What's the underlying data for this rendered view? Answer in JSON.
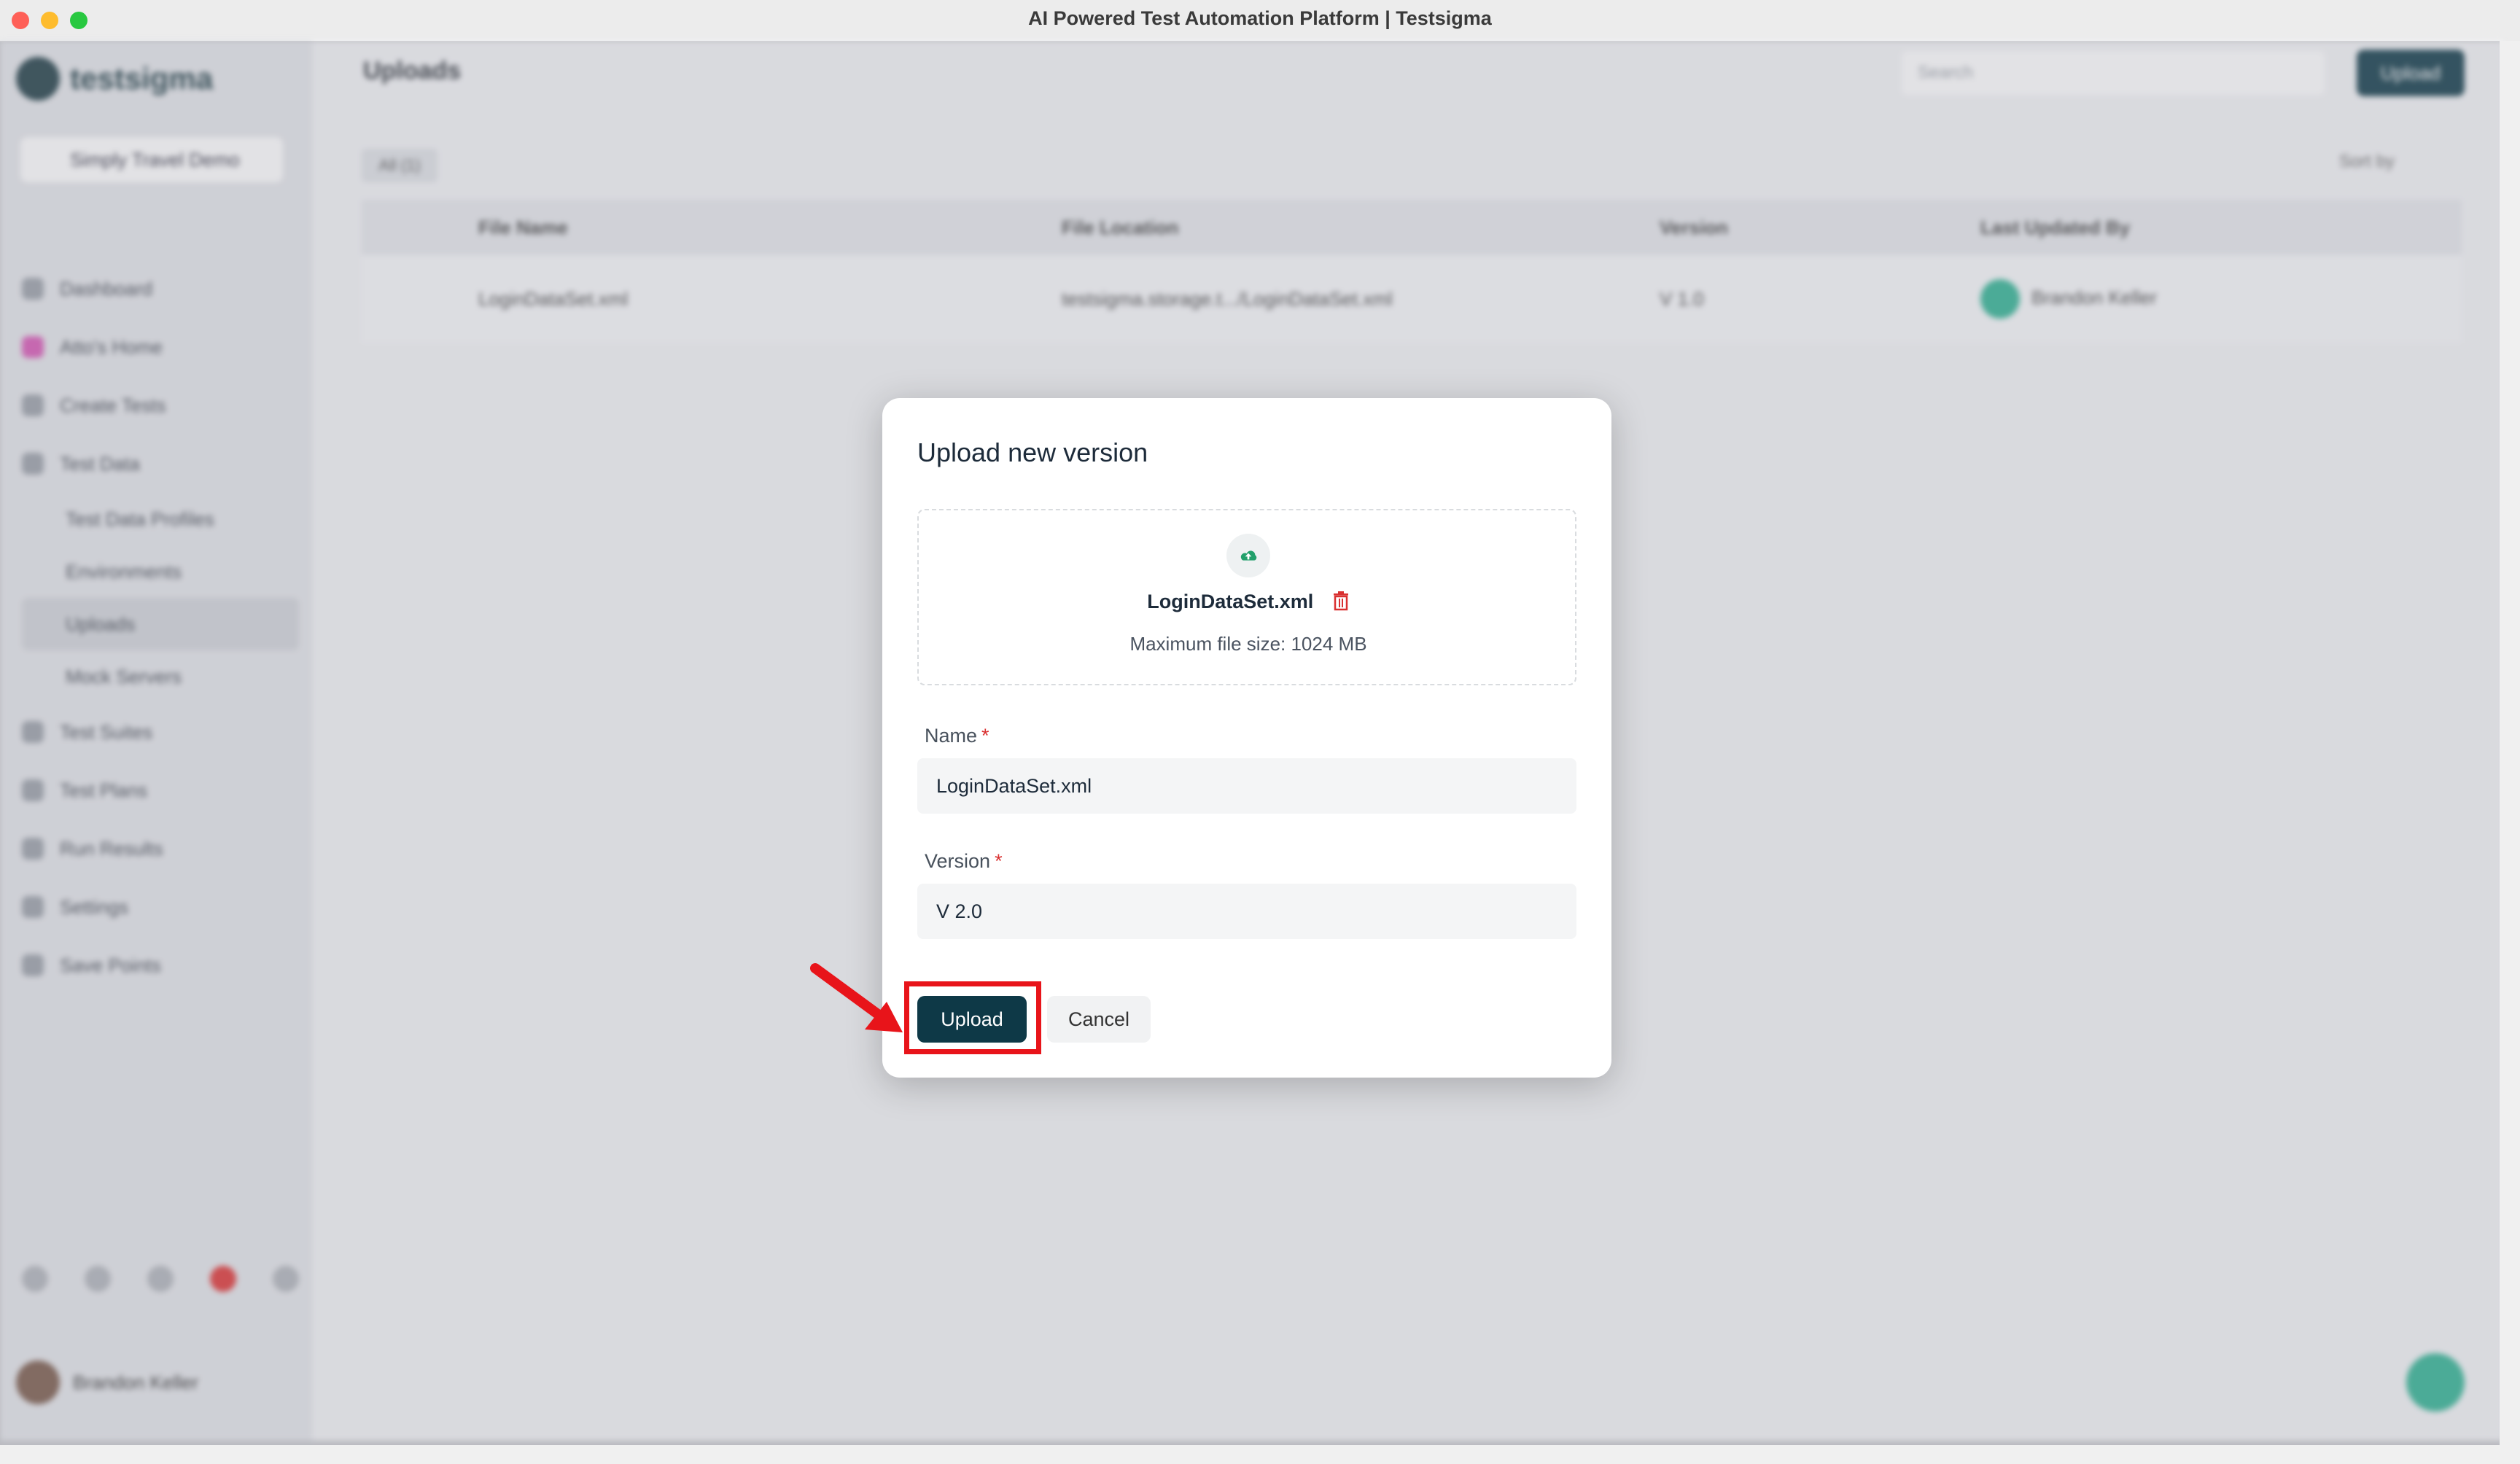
{
  "window": {
    "title": "AI Powered Test Automation Platform | Testsigma"
  },
  "sidebar": {
    "logo_text": "testsigma",
    "project": "Simply Travel Demo",
    "items": [
      {
        "label": "Dashboard",
        "icon": "dashboard-icon"
      },
      {
        "label": "Atto's Home",
        "icon": "atto-icon"
      },
      {
        "label": "Create Tests",
        "icon": "create-tests-icon"
      },
      {
        "label": "Test Data",
        "icon": "test-data-icon"
      },
      {
        "label": "Test Data Profiles"
      },
      {
        "label": "Environments"
      },
      {
        "label": "Uploads"
      },
      {
        "label": "Mock Servers"
      },
      {
        "label": "Test Suites",
        "icon": "test-suites-icon"
      },
      {
        "label": "Test Plans",
        "icon": "test-plans-icon"
      },
      {
        "label": "Run Results",
        "icon": "run-results-icon"
      },
      {
        "label": "Settings",
        "icon": "settings-icon"
      },
      {
        "label": "Save Points",
        "icon": "save-points-icon"
      }
    ],
    "user": {
      "name": "Brandon Keller"
    }
  },
  "main": {
    "title": "Uploads",
    "search_placeholder": "Search",
    "upload_button": "Upload",
    "filter": "All (1)",
    "sort": "Sort by",
    "columns": [
      "File Name",
      "File Location",
      "Version",
      "Last Updated By"
    ],
    "row": {
      "file_name": "LoginDataSet.xml",
      "location": "testsigma.storage.t.../LoginDataSet.xml",
      "version": "V 1.0",
      "updated_by": "Brandon Keller"
    }
  },
  "modal": {
    "title": "Upload new version",
    "file_name": "LoginDataSet.xml",
    "max_size": "Maximum file size: 1024 MB",
    "name_label": "Name",
    "name_value": "LoginDataSet.xml",
    "version_label": "Version",
    "version_value": "V 2.0",
    "required_mark": "*",
    "upload_button": "Upload",
    "cancel_button": "Cancel"
  },
  "colors": {
    "primary": "#0e3947",
    "accent": "#2fb393",
    "danger": "#e8141a",
    "required": "#d93030"
  }
}
